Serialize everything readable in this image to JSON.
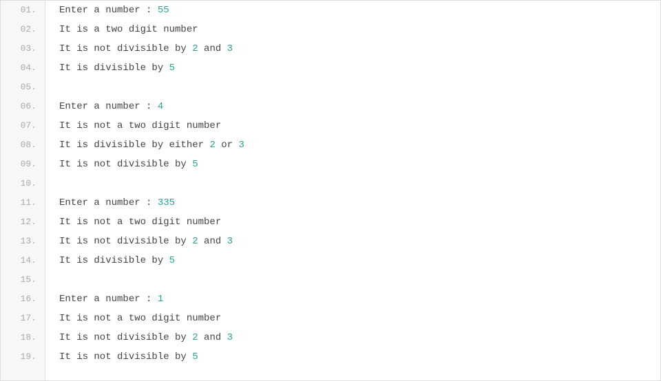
{
  "lines": [
    {
      "num": "01.",
      "content": [
        {
          "text": "Enter a number : ",
          "highlight": false
        },
        {
          "text": "55",
          "highlight": true
        }
      ]
    },
    {
      "num": "02.",
      "content": [
        {
          "text": "It is a two digit number",
          "highlight": false
        }
      ]
    },
    {
      "num": "03.",
      "content": [
        {
          "text": "It is not divisible by ",
          "highlight": false
        },
        {
          "text": "2",
          "highlight": true
        },
        {
          "text": " and ",
          "highlight": false
        },
        {
          "text": "3",
          "highlight": true
        }
      ]
    },
    {
      "num": "04.",
      "content": [
        {
          "text": "It is divisible by ",
          "highlight": false
        },
        {
          "text": "5",
          "highlight": true
        }
      ]
    },
    {
      "num": "05.",
      "content": []
    },
    {
      "num": "06.",
      "content": [
        {
          "text": "Enter a number : ",
          "highlight": false
        },
        {
          "text": "4",
          "highlight": true
        }
      ]
    },
    {
      "num": "07.",
      "content": [
        {
          "text": "It is not a two digit number",
          "highlight": false
        }
      ]
    },
    {
      "num": "08.",
      "content": [
        {
          "text": "It is divisible by either ",
          "highlight": false
        },
        {
          "text": "2",
          "highlight": true
        },
        {
          "text": " or ",
          "highlight": false
        },
        {
          "text": "3",
          "highlight": true
        }
      ]
    },
    {
      "num": "09.",
      "content": [
        {
          "text": "It is not divisible by ",
          "highlight": false
        },
        {
          "text": "5",
          "highlight": true
        }
      ]
    },
    {
      "num": "10.",
      "content": []
    },
    {
      "num": "11.",
      "content": [
        {
          "text": "Enter a number : ",
          "highlight": false
        },
        {
          "text": "335",
          "highlight": true
        }
      ]
    },
    {
      "num": "12.",
      "content": [
        {
          "text": "It is not a two digit number",
          "highlight": false
        }
      ]
    },
    {
      "num": "13.",
      "content": [
        {
          "text": "It is not divisible by ",
          "highlight": false
        },
        {
          "text": "2",
          "highlight": true
        },
        {
          "text": " and ",
          "highlight": false
        },
        {
          "text": "3",
          "highlight": true
        }
      ]
    },
    {
      "num": "14.",
      "content": [
        {
          "text": "It is divisible by ",
          "highlight": false
        },
        {
          "text": "5",
          "highlight": true
        }
      ]
    },
    {
      "num": "15.",
      "content": []
    },
    {
      "num": "16.",
      "content": [
        {
          "text": "Enter a number : ",
          "highlight": false
        },
        {
          "text": "1",
          "highlight": true
        }
      ]
    },
    {
      "num": "17.",
      "content": [
        {
          "text": "It is not a two digit number",
          "highlight": false
        }
      ]
    },
    {
      "num": "18.",
      "content": [
        {
          "text": "It is not divisible by ",
          "highlight": false
        },
        {
          "text": "2",
          "highlight": true
        },
        {
          "text": " and ",
          "highlight": false
        },
        {
          "text": "3",
          "highlight": true
        }
      ]
    },
    {
      "num": "19.",
      "content": [
        {
          "text": "It is not divisible by ",
          "highlight": false
        },
        {
          "text": "5",
          "highlight": true
        }
      ]
    }
  ]
}
